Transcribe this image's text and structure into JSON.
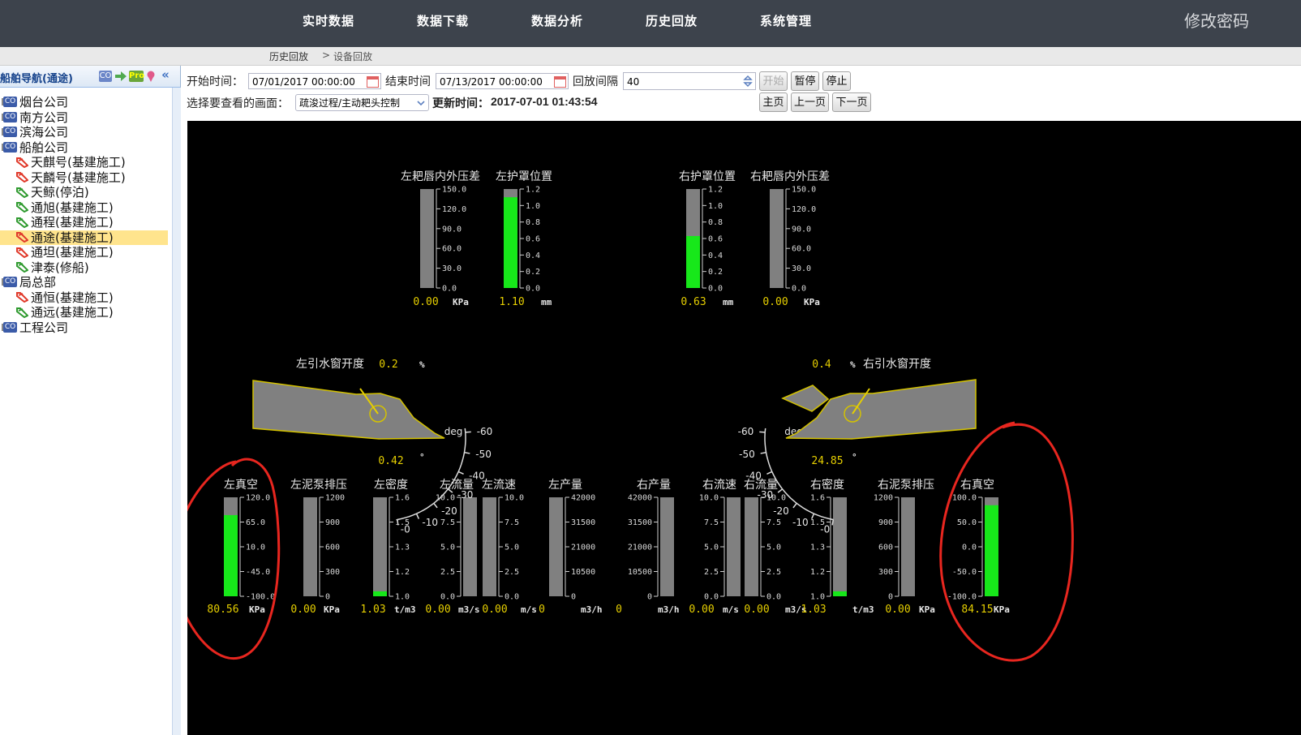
{
  "nav": {
    "items": [
      "实时数据",
      "数据下载",
      "数据分析",
      "历史回放",
      "系统管理"
    ],
    "change_password": "修改密码"
  },
  "breadcrumb": {
    "root": "历史回放",
    "sep": ">",
    "current": "设备回放"
  },
  "sidebar": {
    "title": "船舶导航(通途)",
    "header_icons": [
      "CO",
      "arrow-icon",
      "Pro",
      "pin-icon",
      "collapse-icon"
    ],
    "tree": [
      {
        "label": "烟台公司",
        "type": "company"
      },
      {
        "label": "南方公司",
        "type": "company"
      },
      {
        "label": "滨海公司",
        "type": "company"
      },
      {
        "label": "船舶公司",
        "type": "company"
      },
      {
        "label": "天麒号(基建施工)",
        "type": "ship",
        "status": "red"
      },
      {
        "label": "天麟号(基建施工)",
        "type": "ship",
        "status": "red"
      },
      {
        "label": "天鲸(停泊)",
        "type": "ship",
        "status": "green"
      },
      {
        "label": "通旭(基建施工)",
        "type": "ship",
        "status": "green"
      },
      {
        "label": "通程(基建施工)",
        "type": "ship",
        "status": "green"
      },
      {
        "label": "通途(基建施工)",
        "type": "ship",
        "status": "red",
        "selected": true
      },
      {
        "label": "通坦(基建施工)",
        "type": "ship",
        "status": "red"
      },
      {
        "label": "津泰(修船)",
        "type": "ship",
        "status": "green"
      },
      {
        "label": "局总部",
        "type": "company"
      },
      {
        "label": "通恒(基建施工)",
        "type": "ship",
        "status": "red"
      },
      {
        "label": "通远(基建施工)",
        "type": "ship",
        "status": "green"
      },
      {
        "label": "工程公司",
        "type": "company"
      }
    ]
  },
  "toolbar": {
    "start_label": "开始时间：",
    "start_value": "07/01/2017 00:00:00",
    "end_label": "结束时间",
    "end_value": "07/13/2017 00:00:00",
    "interval_label": "回放间隔",
    "interval_value": "40",
    "btn_start": "开始",
    "btn_pause": "暂停",
    "btn_stop": "停止",
    "screen_label": "选择要查看的画面：",
    "screen_value": "疏浚过程/主动耙头控制",
    "update_label": "更新时间：",
    "update_value": "2017-07-01 01:43:54",
    "btn_home": "主页",
    "btn_prev": "上一页",
    "btn_next": "下一页"
  },
  "colors": {
    "fill": "#17e81a",
    "track": "#808080",
    "value": "#e6cf00",
    "annotation": "#e8261f"
  },
  "panel": {
    "top_gauges": [
      {
        "label": "左耙唇内外压差",
        "value": "0.00",
        "unit": "KPa",
        "ticks": [
          "150.0",
          "120.0",
          "90.0",
          "60.0",
          "30.0",
          "0.0"
        ],
        "fill": 0.0,
        "tick_side": "right"
      },
      {
        "label": "左护罩位置",
        "value": "1.10",
        "unit": "mm",
        "ticks": [
          "1.2",
          "1.0",
          "0.8",
          "0.6",
          "0.4",
          "0.2",
          "0.0"
        ],
        "fill": 0.917,
        "tick_side": "right"
      },
      {
        "label": "右护罩位置",
        "value": "0.63",
        "unit": "mm",
        "ticks": [
          "1.2",
          "1.0",
          "0.8",
          "0.6",
          "0.4",
          "0.2",
          "0.0"
        ],
        "fill": 0.525,
        "tick_side": "right"
      },
      {
        "label": "右耙唇内外压差",
        "value": "0.00",
        "unit": "KPa",
        "ticks": [
          "150.0",
          "120.0",
          "90.0",
          "60.0",
          "30.0",
          "0.0"
        ],
        "fill": 0.0,
        "tick_side": "right"
      }
    ],
    "left_window": {
      "label": "左引水窗开度",
      "value": "0.2",
      "unit": "%",
      "angle": "0.42",
      "angle_unit": "°"
    },
    "right_window": {
      "label": "右引水窗开度",
      "value": "0.4",
      "unit": "%",
      "angle": "24.85",
      "angle_unit": "°"
    },
    "dial": {
      "unit": "deg",
      "ticks": [
        "-60",
        "-50",
        "-40",
        "-30",
        "-20",
        "-10",
        "-0"
      ]
    },
    "bottom_gauges": [
      {
        "label": "左真空",
        "value": "80.56",
        "unit": "KPa",
        "ticks": [
          "120.0",
          "65.0",
          "10.0",
          "-45.0",
          "-100.0"
        ],
        "fill": 0.82,
        "tick_side": "right"
      },
      {
        "label": "左泥泵排压",
        "value": "0.00",
        "unit": "KPa",
        "ticks": [
          "1200",
          "900",
          "600",
          "300",
          "0"
        ],
        "fill": 0.0,
        "tick_side": "right"
      },
      {
        "label": "左密度",
        "value": "1.03",
        "unit": "t/m3",
        "ticks": [
          "1.6",
          "1.5",
          "1.3",
          "1.2",
          "1.0"
        ],
        "fill": 0.05,
        "tick_side": "right"
      },
      {
        "label": "左流量",
        "value": "0.00",
        "unit": "m3/s",
        "ticks": [
          "10.0",
          "7.5",
          "5.0",
          "2.5",
          "0.0"
        ],
        "fill": 0.0,
        "tick_side": "left"
      },
      {
        "label": "左流速",
        "value": "0.00",
        "unit": "m/s",
        "ticks": [
          "10.0",
          "7.5",
          "5.0",
          "2.5",
          "0.0"
        ],
        "fill": 0.0,
        "tick_side": "right"
      },
      {
        "label": "左产量",
        "value": "0",
        "unit": "m3/h",
        "ticks": [
          "42000",
          "31500",
          "21000",
          "10500",
          "0"
        ],
        "fill": 0.0,
        "tick_side": "right"
      },
      {
        "label": "右产量",
        "value": "0",
        "unit": "m3/h",
        "ticks": [
          "42000",
          "31500",
          "21000",
          "10500",
          "0"
        ],
        "fill": 0.0,
        "tick_side": "left"
      },
      {
        "label": "右流速",
        "value": "0.00",
        "unit": "m/s",
        "ticks": [
          "10.0",
          "7.5",
          "5.0",
          "2.5",
          "0.0"
        ],
        "fill": 0.0,
        "tick_side": "left"
      },
      {
        "label": "右流量",
        "value": "0.00",
        "unit": "m3/s",
        "ticks": [
          "10.0",
          "7.5",
          "5.0",
          "2.5",
          "0.0"
        ],
        "fill": 0.0,
        "tick_side": "right"
      },
      {
        "label": "右密度",
        "value": "1.03",
        "unit": "t/m3",
        "ticks": [
          "1.6",
          "1.5",
          "1.3",
          "1.2",
          "1.0"
        ],
        "fill": 0.05,
        "tick_side": "left"
      },
      {
        "label": "右泥泵排压",
        "value": "0.00",
        "unit": "KPa",
        "ticks": [
          "1200",
          "900",
          "600",
          "300",
          "0"
        ],
        "fill": 0.0,
        "tick_side": "left"
      },
      {
        "label": "右真空",
        "value": "84.15",
        "unit": "KPa",
        "ticks": [
          "100.0",
          "50.0",
          "0.0",
          "-50.0",
          "-100.0"
        ],
        "fill": 0.92,
        "tick_side": "left"
      }
    ]
  }
}
